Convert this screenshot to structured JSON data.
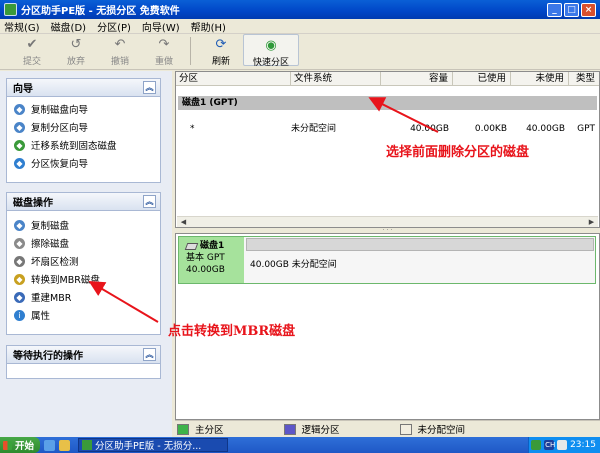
{
  "window": {
    "title": "分区助手PE版 - 无损分区 免费软件"
  },
  "window_buttons": {
    "minimize": "_",
    "restore": "□",
    "close": "×"
  },
  "menu": [
    "常规(G)",
    "磁盘(D)",
    "分区(P)",
    "向导(W)",
    "帮助(H)"
  ],
  "toolbar": {
    "buttons": [
      {
        "label": "提交",
        "icon": "commit-icon",
        "glyph": "✔",
        "enabled": false
      },
      {
        "label": "放弃",
        "icon": "discard-icon",
        "glyph": "↺",
        "enabled": false
      },
      {
        "label": "撤销",
        "icon": "undo-icon",
        "glyph": "↶",
        "enabled": false
      },
      {
        "label": "重做",
        "icon": "redo-icon",
        "glyph": "↷",
        "enabled": false
      }
    ],
    "refresh": {
      "label": "刷新",
      "glyph": "⟳"
    },
    "quick_partition": {
      "label": "快速分区",
      "glyph": "◉"
    }
  },
  "sidebar": {
    "wizard": {
      "title": "向导",
      "collapse": "︽",
      "items": [
        {
          "label": "复制磁盘向导",
          "icon": "copy-disk-wizard-icon",
          "glyph": "◆",
          "color": "#4a84c8"
        },
        {
          "label": "复制分区向导",
          "icon": "copy-partition-wizard-icon",
          "glyph": "◆",
          "color": "#4a84c8"
        },
        {
          "label": "迁移系统到固态磁盘",
          "icon": "migrate-os-ssd-icon",
          "glyph": "◆",
          "color": "#3a9a3a"
        },
        {
          "label": "分区恢复向导",
          "icon": "partition-recovery-icon",
          "glyph": "◆",
          "color": "#2f7fd0"
        }
      ]
    },
    "disk_ops": {
      "title": "磁盘操作",
      "collapse": "︽",
      "items": [
        {
          "label": "复制磁盘",
          "icon": "copy-disk-icon",
          "glyph": "◆",
          "color": "#4a84c8"
        },
        {
          "label": "擦除磁盘",
          "icon": "wipe-disk-icon",
          "glyph": "◆",
          "color": "#8a8a8a"
        },
        {
          "label": "坏扇区检测",
          "icon": "bad-sector-check-icon",
          "glyph": "◆",
          "color": "#777777"
        },
        {
          "label": "转换到MBR磁盘",
          "icon": "convert-to-mbr-icon",
          "glyph": "◆",
          "color": "#c8a020"
        },
        {
          "label": "重建MBR",
          "icon": "rebuild-mbr-icon",
          "glyph": "◆",
          "color": "#3a6ab8"
        },
        {
          "label": "属性",
          "icon": "properties-icon",
          "glyph": "i",
          "color": "#2f7fd0"
        }
      ]
    },
    "pending": {
      "title": "等待执行的操作",
      "collapse": "︽"
    }
  },
  "grid": {
    "columns": [
      "分区",
      "文件系统",
      "容量",
      "已使用",
      "未使用",
      "类型"
    ],
    "disk_header": "磁盘1 (GPT)",
    "rows": [
      {
        "partition": "*",
        "fs": "未分配空间",
        "capacity": "40.00GB",
        "used": "0.00KB",
        "free": "40.00GB",
        "type": "GPT"
      }
    ]
  },
  "disk_map": {
    "disk_name": "磁盘1",
    "disk_type": "基本 GPT",
    "disk_size": "40.00GB",
    "partition_label": "40.00GB 未分配空间"
  },
  "legend": [
    {
      "label": "主分区",
      "color": "#3fb34a"
    },
    {
      "label": "逻辑分区",
      "color": "#5d57c8"
    },
    {
      "label": "未分配空间",
      "color": "#f2eee0"
    }
  ],
  "annotations": {
    "select_disk": "选择前面删除分区的磁盘",
    "convert_mbr": "点击转换到MBR磁盘",
    "color": "#e8141b"
  },
  "taskbar": {
    "start": "开始",
    "task": "分区助手PE版 - 无损分...",
    "ime": "CH",
    "clock": "23:15"
  }
}
